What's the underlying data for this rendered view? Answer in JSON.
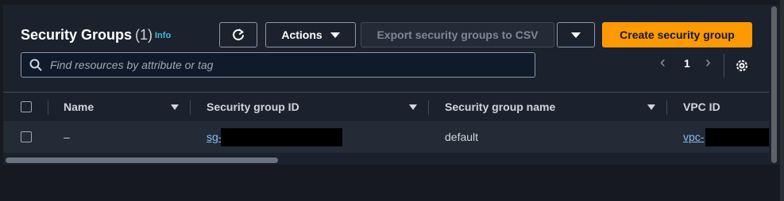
{
  "header": {
    "title": "Security Groups",
    "count": "(1)",
    "info_label": "Info"
  },
  "toolbar": {
    "refresh_icon": "refresh-icon",
    "actions_label": "Actions",
    "export_label": "Export security groups to CSV",
    "create_label": "Create security group"
  },
  "search": {
    "placeholder": "Find resources by attribute or tag"
  },
  "pagination": {
    "prev": "‹",
    "current_page": "1",
    "next": "›"
  },
  "table": {
    "columns": [
      "Name",
      "Security group ID",
      "Security group name",
      "VPC ID"
    ],
    "rows": [
      {
        "name": "–",
        "security_group_id": "sg-",
        "security_group_name": "default",
        "vpc_id": "vpc-"
      }
    ]
  },
  "colors": {
    "accent": "#ff9900",
    "link": "#89bdf7",
    "info": "#44b9d6",
    "background": "#1b222d"
  }
}
